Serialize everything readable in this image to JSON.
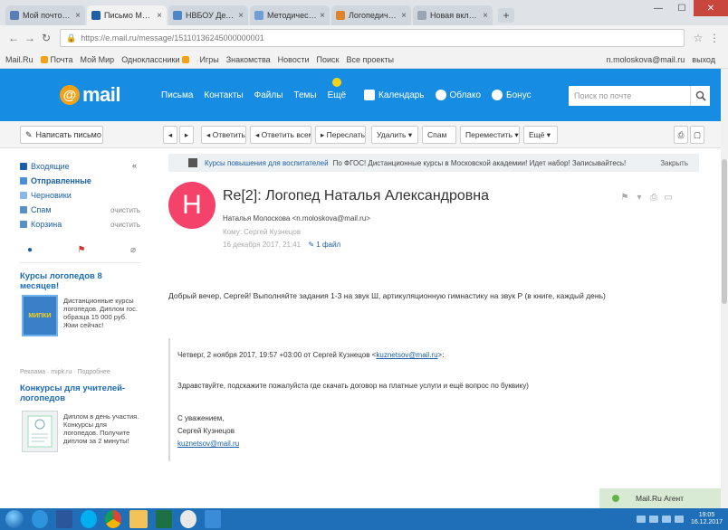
{
  "browser": {
    "tabs": [
      {
        "title": "Мой почтовый ящик",
        "color": "#5a7fb8",
        "active": false
      },
      {
        "title": "Письмо Mail.Ru",
        "color": "#1f5ea8",
        "active": true
      },
      {
        "title": "НВБОУ Детский сад",
        "color": "#4f86c6",
        "active": false
      },
      {
        "title": "Методические пособия",
        "color": "#6f9fd6",
        "active": false
      },
      {
        "title": "Логопедический центр",
        "color": "#e0822a",
        "active": false
      },
      {
        "title": "Новая вкладка",
        "color": "#9aa4b2",
        "active": false
      }
    ],
    "url": "https://e.mail.ru/message/15110136245000000001",
    "bookmarks": [
      "Mail.Ru",
      "Почта",
      "Мой Мир",
      "Одноклассники",
      "Игры",
      "Знакомства",
      "Новости",
      "Поиск",
      "Все проекты"
    ],
    "account": "n.moloskova@mail.ru",
    "exit": "выход"
  },
  "header": {
    "logo_at": "@",
    "logo_text": "mail",
    "nav": [
      "Письма",
      "Контакты",
      "Файлы",
      "Темы",
      "Ещё"
    ],
    "services": [
      "Календарь",
      "Облако",
      "Бонус"
    ],
    "search_placeholder": "Поиск по почте",
    "search_dd": "▾"
  },
  "toolbar": {
    "compose": "Написать письмо",
    "back": "◂",
    "forward": "▸",
    "buttons": [
      "◂ Ответить",
      "◂ Ответить всем",
      "▸ Переслать",
      "Удалить ▾",
      "Спам",
      "Переместить ▾",
      "Ещё ▾"
    ],
    "print": "⎙",
    "view": "▢"
  },
  "sidebar": {
    "folders": [
      {
        "label": "Входящие",
        "count": "",
        "color": "#1a5fa8"
      },
      {
        "label": "Отправленные",
        "count": "",
        "color": "#1a5fa8"
      },
      {
        "label": "Черновики",
        "count": "",
        "color": "#1a5fa8"
      },
      {
        "label": "Спам",
        "count": "очистить",
        "color": "#1a5fa8"
      },
      {
        "label": "Корзина",
        "count": "очистить",
        "color": "#1a5fa8"
      }
    ],
    "collapse": "«",
    "ads": [
      {
        "title": "Курсы логопедов 8 месяцев!",
        "img": "МИПКИ",
        "text": "Дистанционные курсы логопедов. Диплом гос. образца 15 000 руб. Жми сейчас!",
        "meta": "Реклама · mipk.ru · Подробнее"
      },
      {
        "title": "Конкурсы для учителей-логопедов",
        "img": "",
        "text": "Диплом в день участия. Конкурсы для логопедов. Получите диплом за 2 минуты!",
        "meta": ""
      }
    ]
  },
  "message": {
    "banner_link": "Курсы повышения для воспитателей",
    "banner_text": "По ФГОС! Дистанционные курсы в Московской академии! Идет набор! Записывайтесь!",
    "banner_close": "Закрыть",
    "avatar_letter": "Н",
    "subject": "Re[2]: Логопед Наталья Александровна",
    "from": "Наталья Молоскова <n.moloskova@mail.ru>",
    "to": "Кому: Сергей Кузнецов",
    "date": "16 декабря 2017, 21:41",
    "attachment": "1 файл",
    "body_line": "Добрый вечер, Сергей! Выполняйте задания 1-3 на звук Ш, артикуляционную гимнастику на звук Р (в книге, каждый день)",
    "quote_header": "Четверг, 2 ноября 2017, 19:57 +03:00 от Сергей Кузнецов <",
    "quote_email": "kuznetsov@mail.ru",
    "quote_header_end": ">:",
    "quote_body": "Здравствуйте, подскажите пожалуйста где скачать договор на платные услуги и ещё вопрос по буквику)",
    "sign_regards": "С уважением,",
    "sign_name": "Сергей Кузнецов",
    "sign_email": "kuznetsov@mail.ru"
  },
  "agent": {
    "label": "Mail.Ru Агент"
  },
  "clock": {
    "time": "19:05",
    "date": "16.12.2017"
  }
}
